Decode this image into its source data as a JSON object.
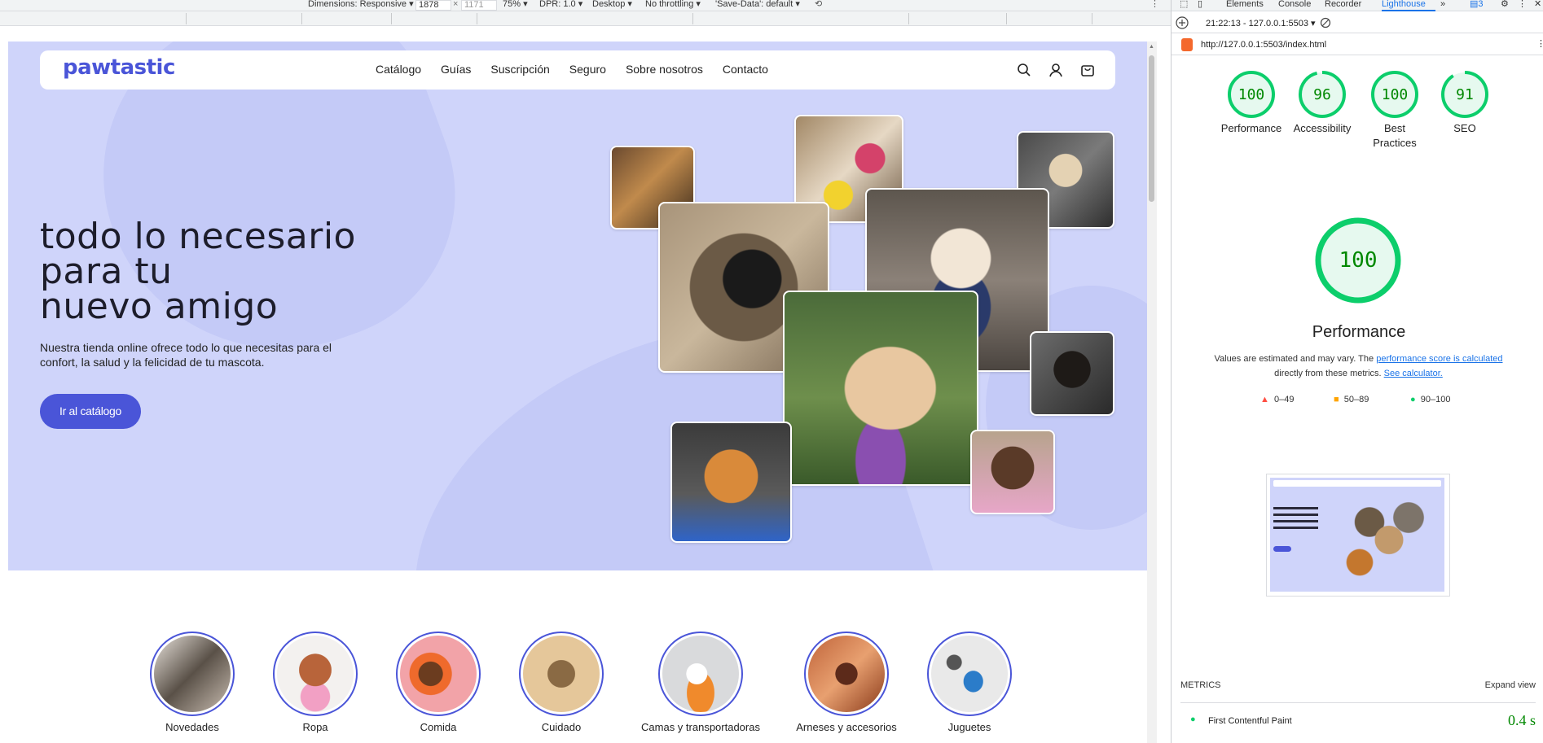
{
  "device_toolbar": {
    "dimensions_label": "Dimensions: Responsive",
    "width_value": "1878",
    "times": "×",
    "height_value": "1171",
    "zoom": "75%",
    "dpr": "DPR: 1.0",
    "device_type": "Desktop",
    "throttling": "No throttling",
    "save_data": "'Save-Data': default"
  },
  "site": {
    "logo": "pawtastic",
    "nav": [
      "Catálogo",
      "Guías",
      "Suscripción",
      "Seguro",
      "Sobre nosotros",
      "Contacto"
    ],
    "hero_title": [
      "todo lo necesario",
      "para tu",
      "nuevo amigo"
    ],
    "hero_desc": "Nuestra tienda online ofrece todo lo que necesitas para el confort, la salud y la felicidad de tu mascota.",
    "cta": "Ir al catálogo",
    "categories": [
      "Novedades",
      "Ropa",
      "Comida",
      "Cuidado",
      "Camas y transportadoras",
      "Arneses y accesorios",
      "Juguetes"
    ]
  },
  "devtools": {
    "tabs": [
      "Elements",
      "Console",
      "Recorder",
      "Lighthouse"
    ],
    "more_tabs": "»",
    "issues_count": "3",
    "report_selector": "21:22:13 - 127.0.0.1:5503",
    "report_url": "http://127.0.0.1:5503/index.html",
    "scores": [
      {
        "label": "Performance",
        "value": 100
      },
      {
        "label": "Accessibility",
        "value": 96
      },
      {
        "label": "Best Practices",
        "value": 100
      },
      {
        "label": "SEO",
        "value": 91
      }
    ],
    "main_score": {
      "label": "Performance",
      "value": 100
    },
    "note_pre": "Values are estimated and may vary. The ",
    "note_link1": "performance score is calculated",
    "note_mid": " directly from these metrics. ",
    "note_link2": "See calculator.",
    "legend": [
      "0–49",
      "50–89",
      "90–100"
    ],
    "metrics_title": "METRICS",
    "expand_view": "Expand view",
    "metric_fcp_label": "First Contentful Paint",
    "metric_fcp_value": "0.4 s"
  },
  "colors": {
    "brand": "#4a55d8",
    "hero_bg": "#cfd4fa",
    "score_good": "#0cce6b",
    "score_good_text": "#008800",
    "score_avg": "#ffa400",
    "score_bad": "#ff4e42"
  }
}
